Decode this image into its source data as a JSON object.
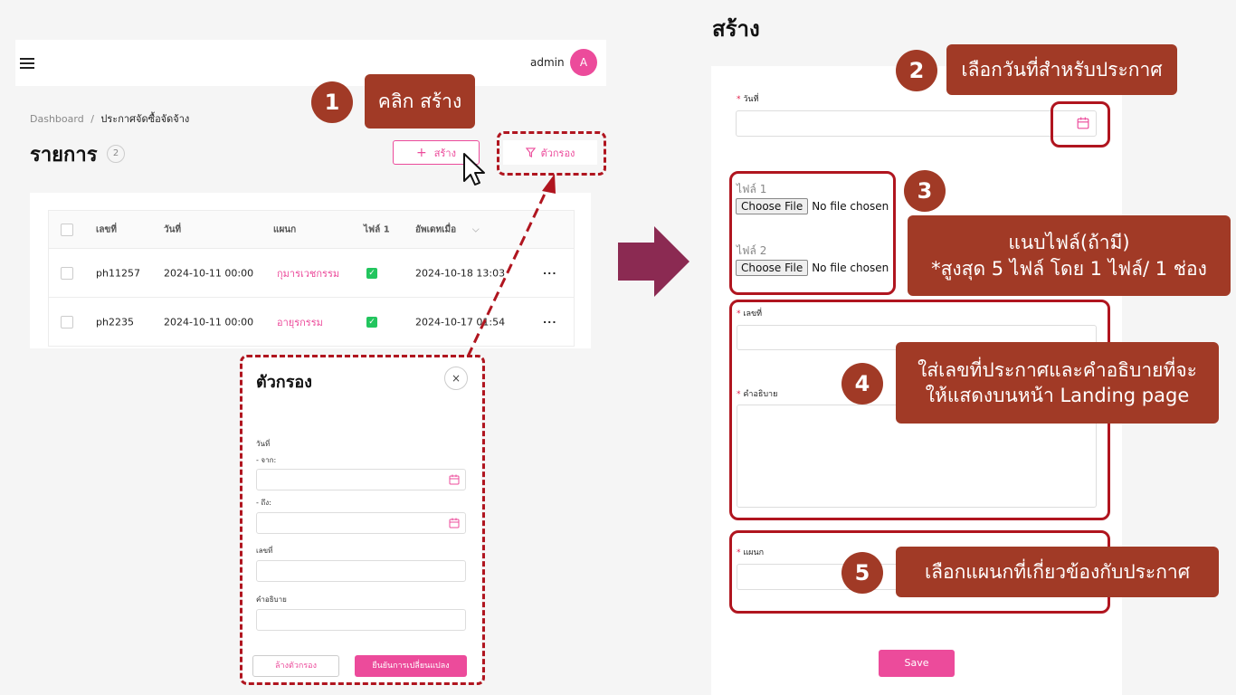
{
  "left_panel": {
    "topbar": {
      "user_name": "admin",
      "avatar_letter": "A"
    },
    "breadcrumb": {
      "root": "Dashboard",
      "separator": "/",
      "current": "ประกาศจัดซื้อจัดจ้าง"
    },
    "page_title": "รายการ",
    "count": "2",
    "create_button": "สร้าง",
    "filter_button": "ตัวกรอง",
    "table": {
      "headers": [
        "เลขที่",
        "วันที่",
        "แผนก",
        "ไฟล์ 1",
        "อัพเดทเมื่อ"
      ],
      "rows": [
        {
          "number": "ph11257",
          "date": "2024-10-11 00:00",
          "department": "กุมารเวชกรรม",
          "updated": "2024-10-18 13:03"
        },
        {
          "number": "ph2235",
          "date": "2024-10-11 00:00",
          "department": "อายุรกรรม",
          "updated": "2024-10-17 01:54"
        }
      ],
      "row_menu": "···"
    },
    "filter_modal": {
      "title": "ตัวกรอง",
      "close": "×",
      "date_label": "วันที่",
      "from_label": "- จาก:",
      "to_label": "- ถึง:",
      "number_label": "เลขที่",
      "description_label": "คำอธิบาย",
      "clear_button": "ล้างตัวกรอง",
      "confirm_button": "ยืนยันการเปลี่ยนแปลง"
    }
  },
  "right_panel": {
    "title": "สร้าง",
    "required_mark": "*",
    "date_label": "วันที่",
    "file1_label": "ไฟล์ 1",
    "file2_label": "ไฟล์ 2",
    "choose_file": "Choose File",
    "no_file": "No file chosen",
    "number_label": "เลขที่",
    "description_label": "คำอธิบาย",
    "department_label": "แผนก",
    "save_button": "Save"
  },
  "callouts": {
    "c1": {
      "num": "1",
      "text": "คลิก สร้าง"
    },
    "c2": {
      "num": "2",
      "text": "เลือกวันที่สำหรับประกาศ"
    },
    "c3": {
      "num": "3",
      "line1": "แนบไฟล์(ถ้ามี)",
      "line2": "*สูงสุด 5 ไฟล์ โดย 1 ไฟล์/ 1 ช่อง"
    },
    "c4": {
      "num": "4",
      "line1": "ใส่เลขที่ประกาศและคำอธิบายที่จะ",
      "line2": "ให้แสดงบนหน้า Landing page"
    },
    "c5": {
      "num": "5",
      "text": "เลือกแผนกที่เกี่ยวข้องกับประกาศ"
    }
  },
  "colors": {
    "accent": "#ec4b9b",
    "callout": "#a13a26",
    "outline": "#b0151f",
    "arrow": "#8b2a52"
  }
}
